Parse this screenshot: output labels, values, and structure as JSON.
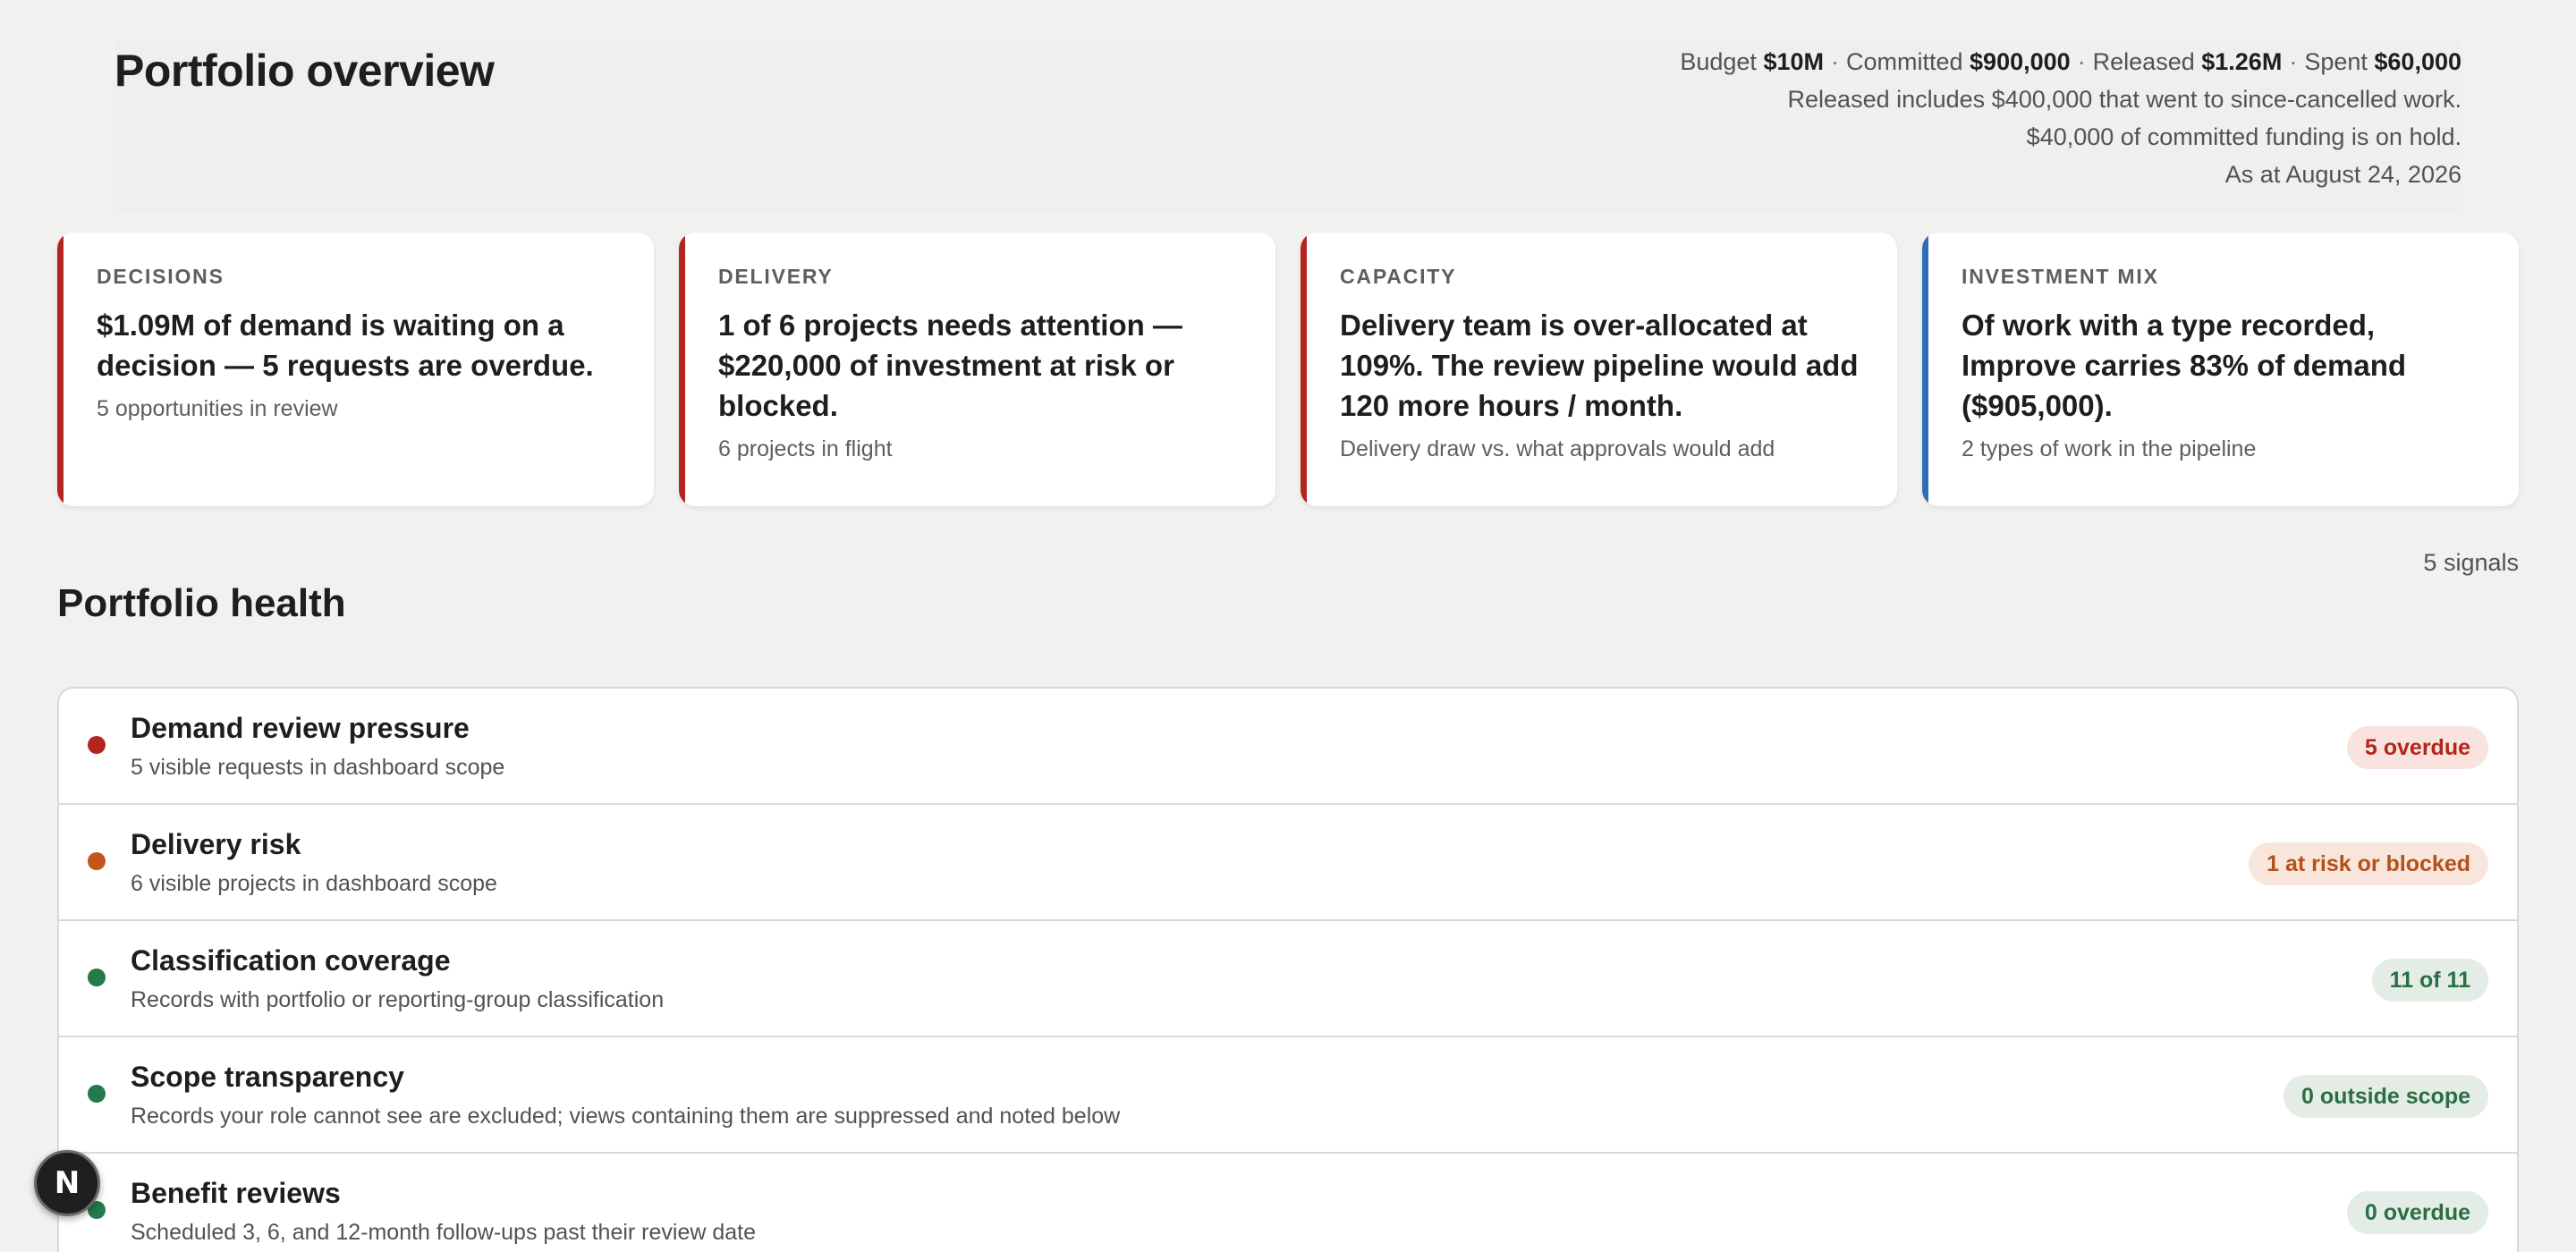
{
  "header": {
    "title": "Portfolio overview",
    "summary": {
      "budget_label": "Budget",
      "budget_value": "$10M",
      "committed_label": "Committed",
      "committed_value": "$900,000",
      "released_label": "Released",
      "released_value": "$1.26M",
      "spent_label": "Spent",
      "spent_value": "$60,000",
      "separator": "·",
      "note_released": "Released includes $400,000 that went to since-cancelled work.",
      "note_hold": "$40,000 of committed funding is on hold.",
      "as_at": "As at August 24, 2026"
    }
  },
  "cards": [
    {
      "kicker": "DECISIONS",
      "headline": "$1.09M of demand is waiting on a decision — 5 requests are overdue.",
      "sub": "5 opportunities in review",
      "accent": "#b3261e"
    },
    {
      "kicker": "DELIVERY",
      "headline": "1 of 6 projects needs attention — $220,000 of investment at risk or blocked.",
      "sub": "6 projects in flight",
      "accent": "#b3261e"
    },
    {
      "kicker": "CAPACITY",
      "headline": "Delivery team is over-allocated at 109%. The review pipeline would add 120 more hours / month.",
      "sub": "Delivery draw vs. what approvals would add",
      "accent": "#b3261e"
    },
    {
      "kicker": "INVESTMENT MIX",
      "headline": "Of work with a type recorded, Improve carries 83% of demand ($905,000).",
      "sub": "2 types of work in the pipeline",
      "accent": "#2f6db5"
    }
  ],
  "health": {
    "title": "Portfolio health",
    "signals": "5 signals",
    "rows": [
      {
        "title": "Demand review pressure",
        "sub": "5 visible requests in dashboard scope",
        "badge": "5 overdue",
        "status": "red",
        "dot_color": "#b3261e"
      },
      {
        "title": "Delivery risk",
        "sub": "6 visible projects in dashboard scope",
        "badge": "1 at risk or blocked",
        "status": "orange",
        "dot_color": "#c2561c"
      },
      {
        "title": "Classification coverage",
        "sub": "Records with portfolio or reporting-group classification",
        "badge": "11 of 11",
        "status": "green",
        "dot_color": "#237a4a"
      },
      {
        "title": "Scope transparency",
        "sub": "Records your role cannot see are excluded; views containing them are suppressed and noted below",
        "badge": "0 outside scope",
        "status": "green",
        "dot_color": "#237a4a"
      },
      {
        "title": "Benefit reviews",
        "sub": "Scheduled 3, 6, and 12-month follow-ups past their review date",
        "badge": "0 overdue",
        "status": "green",
        "dot_color": "#237a4a"
      }
    ]
  },
  "fab": {
    "label": "N",
    "icon": "next-logo-icon"
  }
}
